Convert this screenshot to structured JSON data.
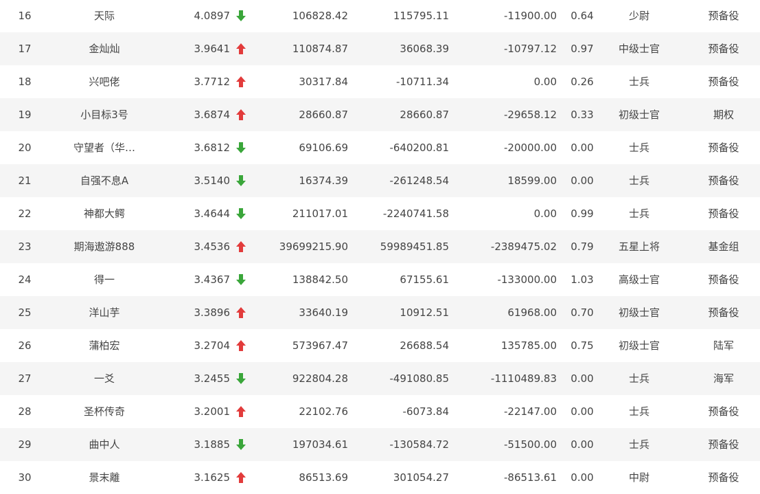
{
  "colors": {
    "up": "#e23b3b",
    "down": "#3aa63a",
    "text": "#444444",
    "row_alt_bg": "#f5f5f5"
  },
  "rows": [
    {
      "rank": "16",
      "name": "天际",
      "score": "4.0897",
      "trend": "down",
      "trend_icon": "arrow-down-icon",
      "v1": "106828.42",
      "v2": "115795.11",
      "v3": "-11900.00",
      "ratio": "0.64",
      "rank_title": "少尉",
      "group": "预备役"
    },
    {
      "rank": "17",
      "name": "金灿灿",
      "score": "3.9641",
      "trend": "up",
      "trend_icon": "arrow-up-icon",
      "v1": "110874.87",
      "v2": "36068.39",
      "v3": "-10797.12",
      "ratio": "0.97",
      "rank_title": "中级士官",
      "group": "预备役"
    },
    {
      "rank": "18",
      "name": "兴吧佬",
      "score": "3.7712",
      "trend": "up",
      "trend_icon": "arrow-up-icon",
      "v1": "30317.84",
      "v2": "-10711.34",
      "v3": "0.00",
      "ratio": "0.26",
      "rank_title": "士兵",
      "group": "预备役"
    },
    {
      "rank": "19",
      "name": "小目标3号",
      "score": "3.6874",
      "trend": "up",
      "trend_icon": "arrow-up-icon",
      "v1": "28660.87",
      "v2": "28660.87",
      "v3": "-29658.12",
      "ratio": "0.33",
      "rank_title": "初级士官",
      "group": "期权"
    },
    {
      "rank": "20",
      "name": "守望者（华…",
      "score": "3.6812",
      "trend": "down",
      "trend_icon": "arrow-down-icon",
      "v1": "69106.69",
      "v2": "-640200.81",
      "v3": "-20000.00",
      "ratio": "0.00",
      "rank_title": "士兵",
      "group": "预备役"
    },
    {
      "rank": "21",
      "name": "自强不息A",
      "score": "3.5140",
      "trend": "down",
      "trend_icon": "arrow-down-icon",
      "v1": "16374.39",
      "v2": "-261248.54",
      "v3": "18599.00",
      "ratio": "0.00",
      "rank_title": "士兵",
      "group": "预备役"
    },
    {
      "rank": "22",
      "name": "神都大鳄",
      "score": "3.4644",
      "trend": "down",
      "trend_icon": "arrow-down-icon",
      "v1": "211017.01",
      "v2": "-2240741.58",
      "v3": "0.00",
      "ratio": "0.99",
      "rank_title": "士兵",
      "group": "预备役"
    },
    {
      "rank": "23",
      "name": "期海遨游888",
      "score": "3.4536",
      "trend": "up",
      "trend_icon": "arrow-up-icon",
      "v1": "39699215.90",
      "v2": "59989451.85",
      "v3": "-2389475.02",
      "ratio": "0.79",
      "rank_title": "五星上将",
      "group": "基金组"
    },
    {
      "rank": "24",
      "name": "得一",
      "score": "3.4367",
      "trend": "down",
      "trend_icon": "arrow-down-icon",
      "v1": "138842.50",
      "v2": "67155.61",
      "v3": "-133000.00",
      "ratio": "1.03",
      "rank_title": "高级士官",
      "group": "预备役"
    },
    {
      "rank": "25",
      "name": "洋山芋",
      "score": "3.3896",
      "trend": "up",
      "trend_icon": "arrow-up-icon",
      "v1": "33640.19",
      "v2": "10912.51",
      "v3": "61968.00",
      "ratio": "0.70",
      "rank_title": "初级士官",
      "group": "预备役"
    },
    {
      "rank": "26",
      "name": "蒲柏宏",
      "score": "3.2704",
      "trend": "up",
      "trend_icon": "arrow-up-icon",
      "v1": "573967.47",
      "v2": "26688.54",
      "v3": "135785.00",
      "ratio": "0.75",
      "rank_title": "初级士官",
      "group": "陆军"
    },
    {
      "rank": "27",
      "name": "一爻",
      "score": "3.2455",
      "trend": "down",
      "trend_icon": "arrow-down-icon",
      "v1": "922804.28",
      "v2": "-491080.85",
      "v3": "-1110489.83",
      "ratio": "0.00",
      "rank_title": "士兵",
      "group": "海军"
    },
    {
      "rank": "28",
      "name": "圣杯传奇",
      "score": "3.2001",
      "trend": "up",
      "trend_icon": "arrow-up-icon",
      "v1": "22102.76",
      "v2": "-6073.84",
      "v3": "-22147.00",
      "ratio": "0.00",
      "rank_title": "士兵",
      "group": "预备役"
    },
    {
      "rank": "29",
      "name": "曲中人",
      "score": "3.1885",
      "trend": "down",
      "trend_icon": "arrow-down-icon",
      "v1": "197034.61",
      "v2": "-130584.72",
      "v3": "-51500.00",
      "ratio": "0.00",
      "rank_title": "士兵",
      "group": "预备役"
    },
    {
      "rank": "30",
      "name": "景末離",
      "score": "3.1625",
      "trend": "up",
      "trend_icon": "arrow-up-icon",
      "v1": "86513.69",
      "v2": "301054.27",
      "v3": "-86513.61",
      "ratio": "0.00",
      "rank_title": "中尉",
      "group": "预备役"
    }
  ]
}
